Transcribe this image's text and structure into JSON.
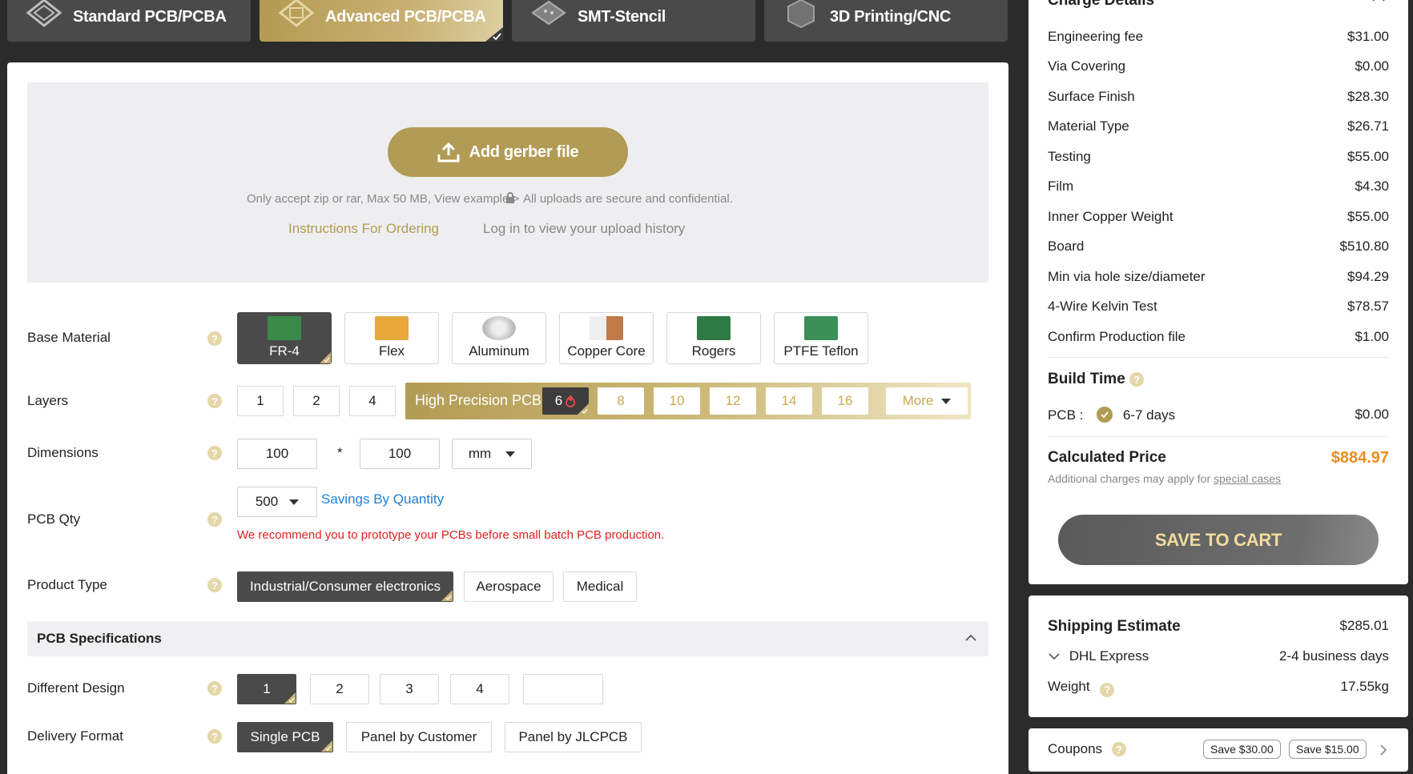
{
  "tabs": [
    {
      "label": "Standard PCB/PCBA",
      "icon": "pcb-layers-icon"
    },
    {
      "label": "Advanced PCB/PCBA",
      "icon": "advanced-pcb-icon"
    },
    {
      "label": "SMT-Stencil",
      "icon": "stencil-icon"
    },
    {
      "label": "3D Printing/CNC",
      "icon": "cube-icon"
    }
  ],
  "upload": {
    "button_label": "Add gerber file",
    "note": "Only accept zip or rar, Max 50 MB, View example >",
    "secure_note": "All uploads are secure and confidential.",
    "instructions_link": "Instructions For Ordering",
    "history_link": "Log in to view your upload history"
  },
  "form": {
    "base_material": {
      "label": "Base Material",
      "options": [
        "FR-4",
        "Flex",
        "Aluminum",
        "Copper Core",
        "Rogers",
        "PTFE Teflon"
      ],
      "selected": "FR-4"
    },
    "layers": {
      "label": "Layers",
      "options": [
        "1",
        "2",
        "4"
      ],
      "hp_label": "High Precision PCB",
      "hp_options": [
        "6",
        "8",
        "10",
        "12",
        "14",
        "16"
      ],
      "selected": "6",
      "more_label": "More"
    },
    "dimensions": {
      "label": "Dimensions",
      "width": "100",
      "height": "100",
      "separator": "*",
      "unit": "mm"
    },
    "qty": {
      "label": "PCB Qty",
      "value": "500",
      "savings_link": "Savings By Quantity",
      "warning": "We recommend you to prototype your PCBs before small batch PCB production."
    },
    "product_type": {
      "label": "Product Type",
      "options": [
        "Industrial/Consumer electronics",
        "Aerospace",
        "Medical"
      ],
      "selected": "Industrial/Consumer electronics"
    },
    "spec_header": "PCB Specifications",
    "different_design": {
      "label": "Different Design",
      "options": [
        "1",
        "2",
        "3",
        "4"
      ],
      "selected": "1"
    },
    "delivery_format": {
      "label": "Delivery Format",
      "options": [
        "Single PCB",
        "Panel by Customer",
        "Panel by JLCPCB"
      ],
      "selected": "Single PCB"
    }
  },
  "charge": {
    "title": "Charge Details",
    "items": [
      {
        "name": "Engineering fee",
        "price": "$31.00"
      },
      {
        "name": "Via Covering",
        "price": "$0.00"
      },
      {
        "name": "Surface Finish",
        "price": "$28.30"
      },
      {
        "name": "Material Type",
        "price": "$26.71"
      },
      {
        "name": "Testing",
        "price": "$55.00"
      },
      {
        "name": "Film",
        "price": "$4.30"
      },
      {
        "name": "Inner Copper Weight",
        "price": "$55.00"
      },
      {
        "name": "Board",
        "price": "$510.80"
      },
      {
        "name": "Min via hole size/diameter",
        "price": "$94.29"
      },
      {
        "name": "4-Wire Kelvin Test",
        "price": "$78.57"
      },
      {
        "name": "Confirm Production file",
        "price": "$1.00"
      }
    ],
    "build_time": {
      "title": "Build Time",
      "label": "PCB :",
      "option": "6-7 days",
      "price": "$0.00"
    },
    "calculated": {
      "label": "Calculated Price",
      "price": "$884.97",
      "note": "Additional charges may apply for",
      "note_link": "special cases"
    },
    "save_button": "SAVE TO CART"
  },
  "shipping": {
    "title": "Shipping Estimate",
    "price": "$285.01",
    "carrier": "DHL Express",
    "days": "2-4 business days",
    "weight_label": "Weight",
    "weight": "17.55kg"
  },
  "coupons": {
    "label": "Coupons",
    "tags": [
      "Save $30.00",
      "Save $15.00"
    ]
  },
  "colors": {
    "gold": "#b29b55",
    "dark": "#4a4a4a",
    "price_orange": "#f08c1e",
    "link_blue": "#1e7fd8",
    "warning_red": "#e02020"
  }
}
